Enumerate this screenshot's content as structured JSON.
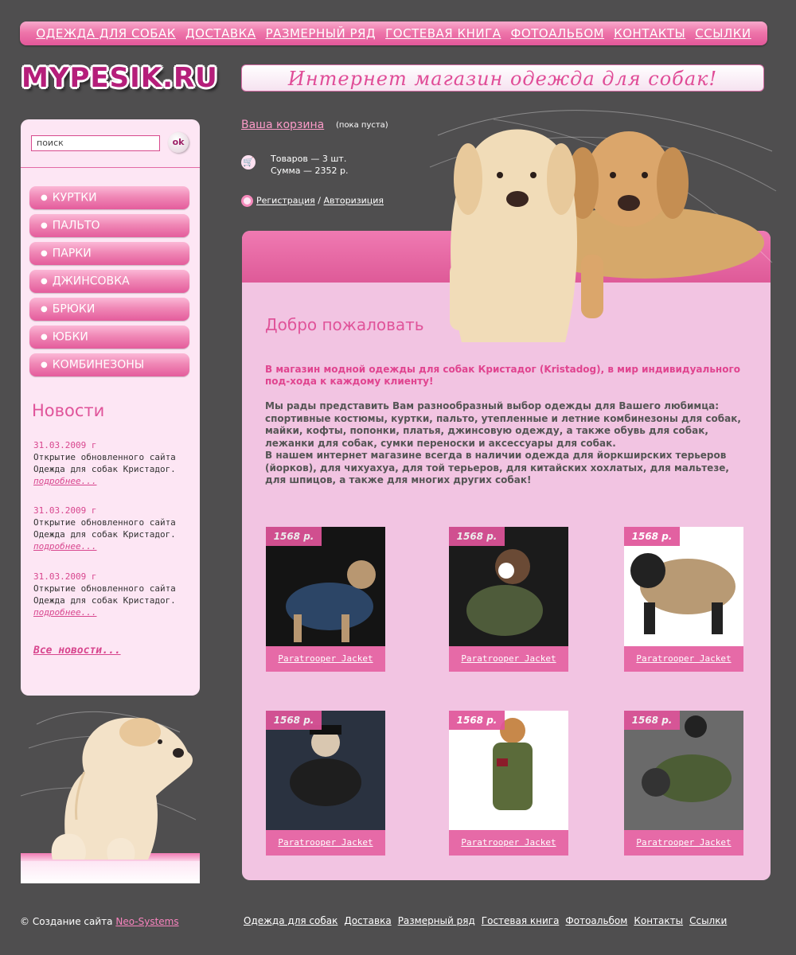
{
  "nav": {
    "items": [
      "ОДЕЖДА ДЛЯ СОБАК",
      "ДОСТАВКА",
      "РАЗМЕРНЫЙ РЯД",
      "ГОСТЕВАЯ КНИГА",
      "ФОТОАЛЬБОМ",
      "КОНТАКТЫ",
      "ССЫЛКИ"
    ]
  },
  "logo": "MYPESIK.RU",
  "slogan": "Интернет магазин одежда для собак!",
  "search": {
    "value": "поиск",
    "button": "ok"
  },
  "categories": [
    "КУРТКИ",
    "ПАЛЬТО",
    "ПАРКИ",
    "ДЖИНСОВКА",
    "БРЮКИ",
    "ЮБКИ",
    "КОМБИНЕЗОНЫ"
  ],
  "news": {
    "title": "Новости",
    "items": [
      {
        "date": "31.03.2009 г",
        "text": "Открытие обновленного сайта Одежда для собак Кристадог.",
        "more": "подробнее..."
      },
      {
        "date": "31.03.2009 г",
        "text": "Открытие обновленного сайта Одежда для собак Кристадог.",
        "more": "подробнее..."
      },
      {
        "date": "31.03.2009 г",
        "text": "Открытие обновленного сайта Одежда для собак Кристадог.",
        "more": "подробнее..."
      }
    ],
    "all": "Все новости..."
  },
  "cart": {
    "title": "Ваша корзина",
    "status": "(пока пуста)",
    "items": "Товаров — 3 шт.",
    "sum": "Сумма — 2352 р."
  },
  "auth": {
    "register": "Регистрация",
    "separator": "/",
    "login": "Авторизиция"
  },
  "main": {
    "welcome": "Добро пожаловать",
    "intro1": "В магазин модной одежды для собак Кристадог (Kristadog), в мир индивидуального под-хода к каждому клиенту!",
    "intro2": "Мы рады представить Вам разнообразный выбор одежды для Вашего любимца: спортивные костюмы, куртки, пальто, утепленные и летние комбинезоны для собак, майки, кофты, попонки, платья, джинсовую одежду, а также обувь для собак, лежанки для собак, сумки переноски и аксессуары для собак.\nВ нашем интернет магазине всегда в наличии одежда для йоркширских терьеров (йорков), для чихуахуа, для той терьеров, для китайских хохлатых, для мальтезе, для шпицов, а также для многих других собак!"
  },
  "products": [
    {
      "price": "1568 р.",
      "name": "Paratrooper Jacket"
    },
    {
      "price": "1568 р.",
      "name": "Paratrooper Jacket"
    },
    {
      "price": "1568 р.",
      "name": "Paratrooper Jacket"
    },
    {
      "price": "1568 р.",
      "name": "Paratrooper Jacket"
    },
    {
      "price": "1568 р.",
      "name": "Paratrooper Jacket"
    },
    {
      "price": "1568 р.",
      "name": "Paratrooper Jacket"
    }
  ],
  "footer": {
    "copyright": "© Создание сайта",
    "developer": "Neo-Systems",
    "links": [
      "Одежда для собак",
      "Доставка",
      "Размерный ряд",
      "Гостевая книга",
      "Фотоальбом",
      "Контакты",
      "Ссылки"
    ]
  },
  "colors": {
    "accent": "#e0549a",
    "background": "#4f4e4f",
    "panel": "#f2c4e2"
  }
}
